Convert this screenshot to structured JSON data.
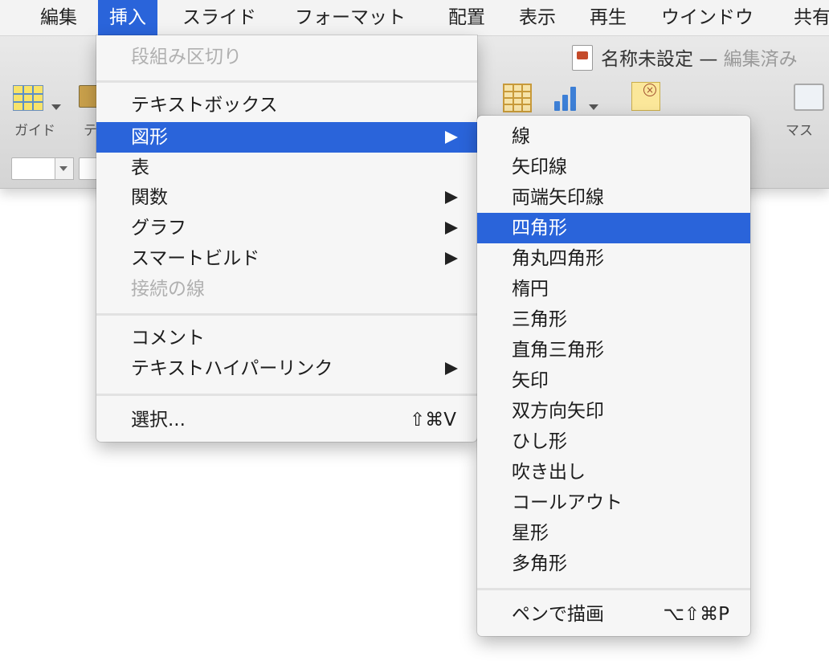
{
  "menubar": {
    "items": [
      "編集",
      "挿入",
      "スライド",
      "フォーマット",
      "配置",
      "表示",
      "再生",
      "ウインドウ",
      "共有"
    ]
  },
  "window": {
    "title": "名称未設定",
    "dash": "—",
    "status": "編集済み",
    "toolbar": {
      "guide_label": "ガイド",
      "theme_label": "テ",
      "master_label": "マス"
    }
  },
  "insert_menu": {
    "column_break": "段組み区切り",
    "text_box": "テキストボックス",
    "shape": "図形",
    "table": "表",
    "function": "関数",
    "chart": "グラフ",
    "smart_build": "スマートビルド",
    "connection_line": "接続の線",
    "comment": "コメント",
    "text_hyperlink": "テキストハイパーリンク",
    "choose": "選択...",
    "choose_shortcut": "⇧⌘V"
  },
  "shape_menu": {
    "items": [
      "線",
      "矢印線",
      "両端矢印線",
      "四角形",
      "角丸四角形",
      "楕円",
      "三角形",
      "直角三角形",
      "矢印",
      "双方向矢印",
      "ひし形",
      "吹き出し",
      "コールアウト",
      "星形",
      "多角形"
    ],
    "highlighted": "四角形",
    "draw_with_pen": "ペンで描画",
    "draw_with_pen_shortcut": "⌥⇧⌘P"
  },
  "colors": {
    "highlight": "#2a64da",
    "menu_bg": "#f6f6f6",
    "disabled_text": "#b0b0b0"
  }
}
